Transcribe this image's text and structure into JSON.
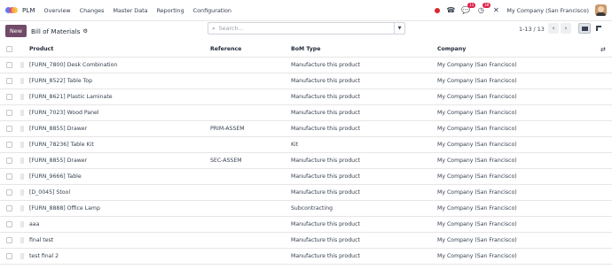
{
  "navbar": {
    "app_name": "PLM",
    "menu": [
      "Overview",
      "Changes",
      "Master Data",
      "Reporting",
      "Configuration"
    ],
    "messages_badge": "11",
    "activities_badge": "38",
    "company": "My Company (San Francisco)"
  },
  "control": {
    "new_label": "New",
    "title": "Bill of Materials",
    "search_placeholder": "Search...",
    "pager": "1-13 / 13"
  },
  "table": {
    "columns": [
      "Product",
      "Reference",
      "BoM Type",
      "Company"
    ],
    "rows": [
      {
        "product": "[FURN_7800] Desk Combination",
        "reference": "",
        "bom_type": "Manufacture this product",
        "company": "My Company (San Francisco)"
      },
      {
        "product": "[FURN_8522] Table Top",
        "reference": "",
        "bom_type": "Manufacture this product",
        "company": "My Company (San Francisco)"
      },
      {
        "product": "[FURN_8621] Plastic Laminate",
        "reference": "",
        "bom_type": "Manufacture this product",
        "company": "My Company (San Francisco)"
      },
      {
        "product": "[FURN_7023] Wood Panel",
        "reference": "",
        "bom_type": "Manufacture this product",
        "company": "My Company (San Francisco)"
      },
      {
        "product": "[FURN_8855] Drawer",
        "reference": "PRIM-ASSEM",
        "bom_type": "Manufacture this product",
        "company": "My Company (San Francisco)"
      },
      {
        "product": "[FURN_78236] Table Kit",
        "reference": "",
        "bom_type": "Kit",
        "company": "My Company (San Francisco)"
      },
      {
        "product": "[FURN_8855] Drawer",
        "reference": "SEC-ASSEM",
        "bom_type": "Manufacture this product",
        "company": "My Company (San Francisco)"
      },
      {
        "product": "[FURN_9666] Table",
        "reference": "",
        "bom_type": "Manufacture this product",
        "company": "My Company (San Francisco)"
      },
      {
        "product": "[D_0045] Stool",
        "reference": "",
        "bom_type": "Manufacture this product",
        "company": "My Company (San Francisco)"
      },
      {
        "product": "[FURN_8888] Office Lamp",
        "reference": "",
        "bom_type": "Subcontracting",
        "company": "My Company (San Francisco)"
      },
      {
        "product": "aaa",
        "reference": "",
        "bom_type": "Manufacture this product",
        "company": "My Company (San Francisco)"
      },
      {
        "product": "final test",
        "reference": "",
        "bom_type": "Manufacture this product",
        "company": "My Company (San Francisco)"
      },
      {
        "product": "test final 2",
        "reference": "",
        "bom_type": "Manufacture this product",
        "company": "My Company (San Francisco)"
      }
    ]
  },
  "colors": {
    "brand": "#714b67",
    "record_dot": "#d9262e",
    "badge": "#e0204a"
  }
}
